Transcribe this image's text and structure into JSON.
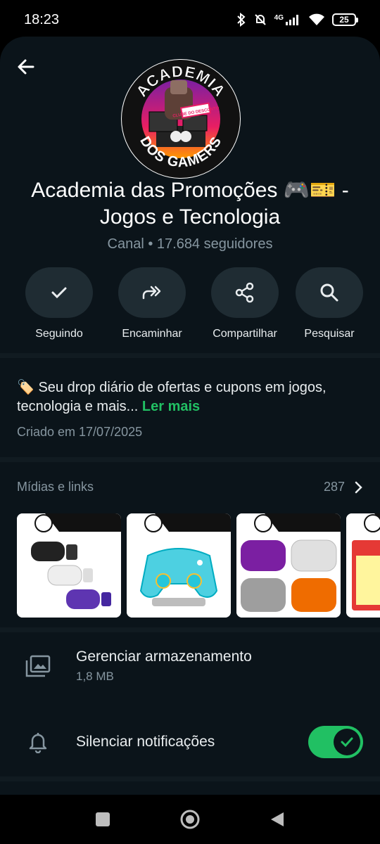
{
  "status_bar": {
    "time": "18:23",
    "network": "4G",
    "battery": "25"
  },
  "channel": {
    "title": "Academia das Promoções 🎮🎫 - Jogos e Tecnologia",
    "title_line1": "Academia das Promoções 🎮🎫 -",
    "title_line2": "Jogos e Tecnologia",
    "subtitle": "Canal • 17.684 seguidores",
    "avatar_logo": {
      "text_top": "ACADEMIA",
      "text_bottom": "DOS GAMERS",
      "badge": "CLUBE DO DESCONTO"
    }
  },
  "actions": [
    {
      "label": "Seguindo",
      "icon": "check-icon"
    },
    {
      "label": "Encaminhar",
      "icon": "forward-icon"
    },
    {
      "label": "Compartilhar",
      "icon": "share-icon"
    },
    {
      "label": "Pesquisar",
      "icon": "search-icon"
    }
  ],
  "description": {
    "emoji": "🏷️",
    "text": "Seu drop diário de ofertas e cupons em jogos, tecnologia e mais...",
    "read_more": "Ler mais",
    "created": "Criado em 17/07/2025"
  },
  "media": {
    "title": "Mídias e links",
    "count": "287"
  },
  "settings": {
    "storage": {
      "label": "Gerenciar armazenamento",
      "value": "1,8 MB"
    },
    "mute": {
      "label": "Silenciar notificações",
      "enabled": true
    }
  },
  "colors": {
    "background": "#0b141a",
    "accent": "#21c063",
    "button_bg": "#1f2c33",
    "muted_text": "#8696a0"
  }
}
